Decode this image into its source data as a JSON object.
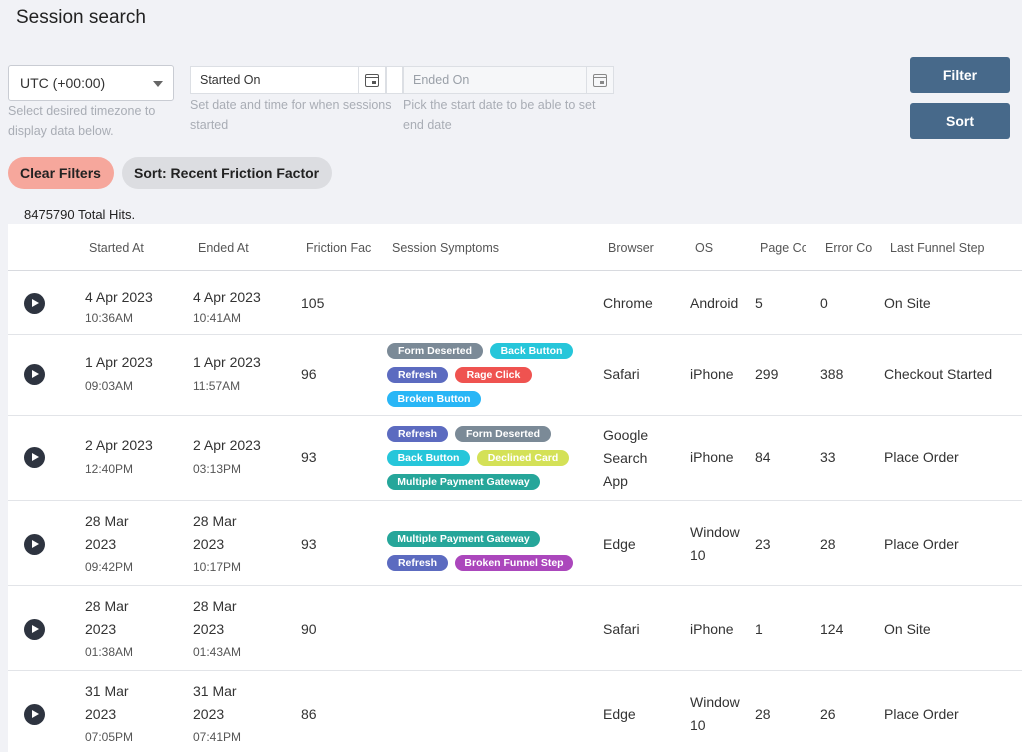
{
  "page": {
    "title": "Session search"
  },
  "filters": {
    "timezone": {
      "value": "UTC (+00:00)",
      "helper": "Select desired timezone to display data below."
    },
    "started_on": {
      "placeholder": "Started On",
      "helper": "Set date and time for when sessions started"
    },
    "ended_on": {
      "placeholder": "Ended On",
      "helper": "Pick the start date to be able to set end date"
    },
    "filter_label": "Filter",
    "sort_label": "Sort",
    "clear_label": "Clear Filters",
    "sort_chip_label": "Sort: Recent Friction Factor"
  },
  "total_hits": "8475790 Total Hits.",
  "table": {
    "headers": [
      "Started At",
      "Ended At",
      "Friction Fac",
      "Session Symptoms",
      "Browser",
      "OS",
      "Page Co",
      "Error Co",
      "Last Funnel Step"
    ],
    "rows": [
      {
        "start_date": "4 Apr 2023",
        "start_time": "10:36AM",
        "end_date": "4 Apr 2023",
        "end_time": "10:41AM",
        "friction": "105",
        "symptoms": [],
        "browser": "Chrome",
        "os": "Android",
        "pages": "5",
        "errors": "0",
        "funnel": "On Site"
      },
      {
        "start_date": "1 Apr 2023",
        "start_time": "09:03AM",
        "end_date": "1 Apr 2023",
        "end_time": "11:57AM",
        "friction": "96",
        "symptoms": [
          "Form Deserted",
          "Back Button",
          "Refresh",
          "Rage Click",
          "Broken Button"
        ],
        "browser": "Safari",
        "os": "iPhone",
        "pages": "299",
        "errors": "388",
        "funnel": "Checkout Started"
      },
      {
        "start_date": "2 Apr 2023",
        "start_time": "12:40PM",
        "end_date": "2 Apr 2023",
        "end_time": "03:13PM",
        "friction": "93",
        "symptoms": [
          "Refresh",
          "Form Deserted",
          "Back Button",
          "Declined Card",
          "Multiple Payment Gateway"
        ],
        "browser": "Google Search App",
        "os": "iPhone",
        "pages": "84",
        "errors": "33",
        "funnel": "Place Order"
      },
      {
        "start_date": "28 Mar 2023",
        "start_time": "09:42PM",
        "end_date": "28 Mar 2023",
        "end_time": "10:17PM",
        "friction": "93",
        "symptoms": [
          "Multiple Payment Gateway",
          "Refresh",
          "Broken Funnel Step"
        ],
        "browser": "Edge",
        "os": "Window 10",
        "pages": "23",
        "errors": "28",
        "funnel": "Place Order"
      },
      {
        "start_date": "28 Mar 2023",
        "start_time": "01:38AM",
        "end_date": "28 Mar 2023",
        "end_time": "01:43AM",
        "friction": "90",
        "symptoms": [],
        "browser": "Safari",
        "os": "iPhone",
        "pages": "1",
        "errors": "124",
        "funnel": "On Site"
      },
      {
        "start_date": "31 Mar 2023",
        "start_time": "07:05PM",
        "end_date": "31 Mar 2023",
        "end_time": "07:41PM",
        "friction": "86",
        "symptoms": [],
        "browser": "Edge",
        "os": "Window 10",
        "pages": "28",
        "errors": "26",
        "funnel": "Place Order"
      }
    ]
  },
  "tag_colors": {
    "Form Deserted": "#7b8a97",
    "Back Button": "#26c6da",
    "Refresh": "#5c6bc0",
    "Rage Click": "#ef5350",
    "Broken Button": "#29b6f6",
    "Declined Card": "#d4e157",
    "Multiple Payment Gateway": "#26a69a",
    "Broken Funnel Step": "#ab47bc"
  }
}
